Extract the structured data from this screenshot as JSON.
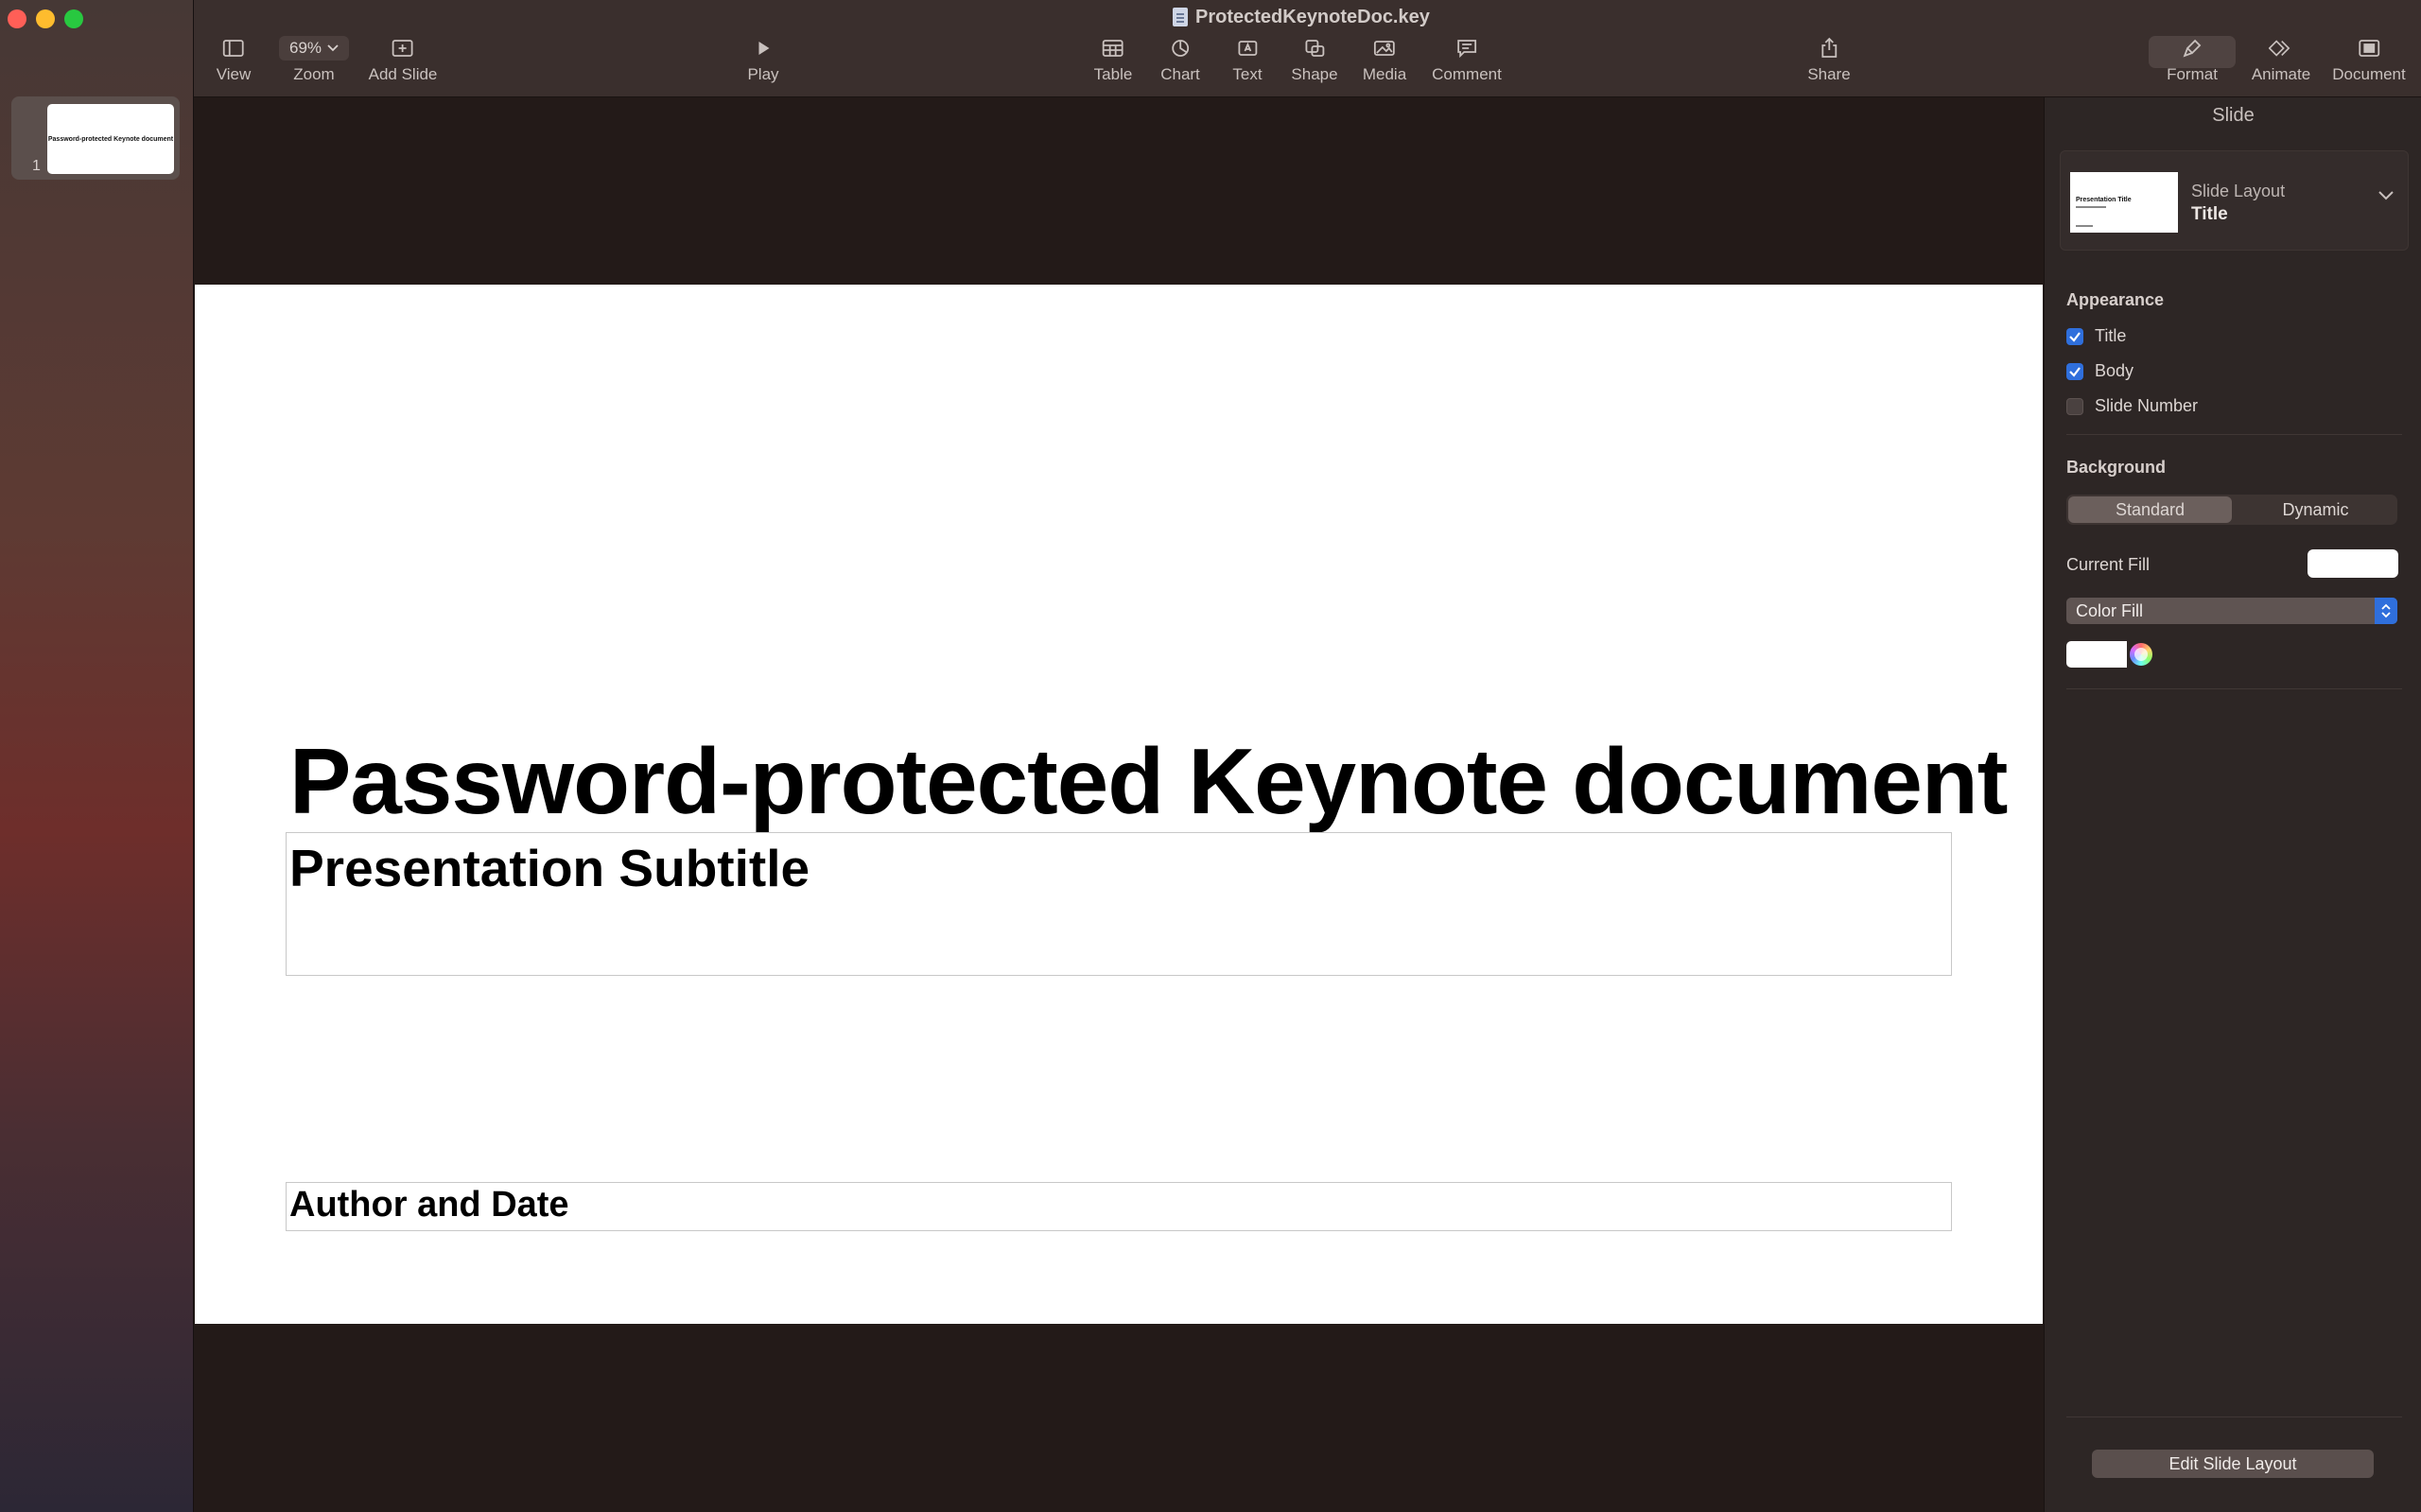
{
  "window": {
    "title": "ProtectedKeynoteDoc.key"
  },
  "colors": {
    "accent": "#2f6fdc",
    "close": "#ff5f57",
    "minimize": "#febc2e",
    "zoom": "#28c840"
  },
  "toolbar": {
    "view": "View",
    "zoom_value": "69%",
    "zoom": "Zoom",
    "add_slide": "Add Slide",
    "play": "Play",
    "table": "Table",
    "chart": "Chart",
    "text": "Text",
    "shape": "Shape",
    "media": "Media",
    "comment": "Comment",
    "share": "Share",
    "format": "Format",
    "animate": "Animate",
    "document": "Document"
  },
  "navigator": {
    "slides": [
      {
        "number": "1",
        "thumb_title": "Password-protected Keynote document"
      }
    ]
  },
  "slide": {
    "title": "Password-protected Keynote document",
    "subtitle": "Presentation Subtitle",
    "author": "Author and Date"
  },
  "inspector": {
    "header": "Slide",
    "layout_label": "Slide Layout",
    "layout_value": "Title",
    "layout_thumb_title": "Presentation Title",
    "appearance": {
      "title": "Appearance",
      "items": [
        {
          "label": "Title",
          "checked": true
        },
        {
          "label": "Body",
          "checked": true
        },
        {
          "label": "Slide Number",
          "checked": false
        }
      ]
    },
    "background": {
      "title": "Background",
      "modes": [
        "Standard",
        "Dynamic"
      ],
      "selected_mode": "Standard",
      "current_fill_label": "Current Fill",
      "fill_type": "Color Fill",
      "fill_color": "#ffffff"
    },
    "edit_layout_button": "Edit Slide Layout"
  }
}
